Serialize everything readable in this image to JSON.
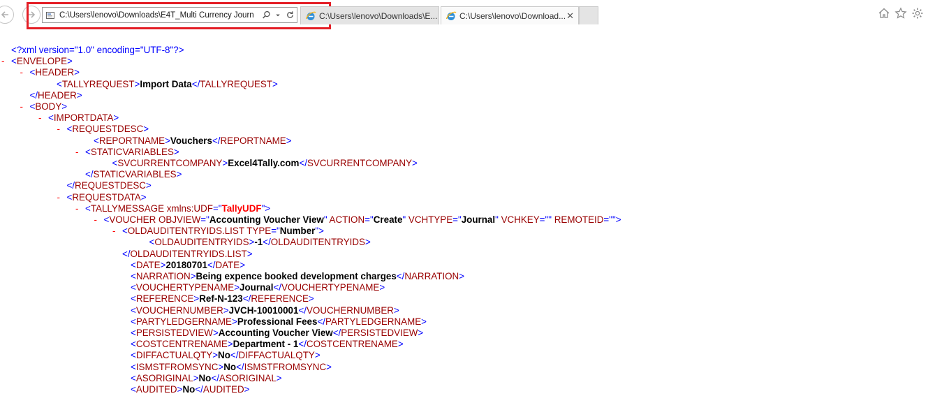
{
  "browser": {
    "address_url": "C:\\Users\\lenovo\\Downloads\\E4T_Multi Currency Journ",
    "tabs": [
      {
        "title": "C:\\Users\\lenovo\\Downloads\\E..."
      },
      {
        "title": "C:\\Users\\lenovo\\Download..."
      }
    ],
    "icons": [
      "back-icon",
      "forward-icon",
      "page-icon",
      "search-icon",
      "dropdown-icon",
      "refresh-icon",
      "ie-icon",
      "close-icon",
      "home-icon",
      "star-icon",
      "gear-icon"
    ],
    "colors": {
      "highlight": "#e41e26",
      "tag": "#990000",
      "bracket": "#0000ff",
      "minus": "#ff0000"
    }
  },
  "xml": {
    "declaration": "<?xml version=\"1.0\" encoding=\"UTF-8\"?>",
    "lines": [
      {
        "open": "ENVELOPE"
      },
      {
        "open": "HEADER"
      },
      {
        "tag": "TALLYREQUEST",
        "value": "Import Data"
      },
      {
        "close": "HEADER"
      },
      {
        "open": "BODY"
      },
      {
        "open": "IMPORTDATA"
      },
      {
        "open": "REQUESTDESC"
      },
      {
        "tag": "REPORTNAME",
        "value": "Vouchers"
      },
      {
        "open": "STATICVARIABLES"
      },
      {
        "tag": "SVCURRENTCOMPANY",
        "value": "Excel4Tally.com"
      },
      {
        "close": "STATICVARIABLES"
      },
      {
        "close": "REQUESTDESC"
      },
      {
        "open": "REQUESTDATA"
      },
      {
        "open": "TALLYMESSAGE",
        "attrs": [
          {
            "name": "xmlns:UDF",
            "value": "TallyUDF",
            "red": true
          }
        ]
      },
      {
        "open": "VOUCHER",
        "attrs": [
          {
            "name": "OBJVIEW",
            "value": "Accounting Voucher View"
          },
          {
            "name": "ACTION",
            "value": "Create"
          },
          {
            "name": "VCHTYPE",
            "value": "Journal"
          },
          {
            "name": "VCHKEY",
            "value": ""
          },
          {
            "name": "REMOTEID",
            "value": ""
          }
        ]
      },
      {
        "open": "OLDAUDITENTRYIDS.LIST",
        "attrs": [
          {
            "name": "TYPE",
            "value": "Number"
          }
        ]
      },
      {
        "tag": "OLDAUDITENTRYIDS",
        "value": "-1"
      },
      {
        "close": "OLDAUDITENTRYIDS.LIST"
      },
      {
        "tag": "DATE",
        "value": "20180701"
      },
      {
        "tag": "NARRATION",
        "value": "Being expence booked development charges"
      },
      {
        "tag": "VOUCHERTYPENAME",
        "value": "Journal"
      },
      {
        "tag": "REFERENCE",
        "value": "Ref-N-123"
      },
      {
        "tag": "VOUCHERNUMBER",
        "value": "JVCH-10010001"
      },
      {
        "tag": "PARTYLEDGERNAME",
        "value": "Professional Fees"
      },
      {
        "tag": "PERSISTEDVIEW",
        "value": "Accounting Voucher View"
      },
      {
        "tag": "COSTCENTRENAME",
        "value": "Department - 1"
      },
      {
        "tag": "DIFFACTUALQTY",
        "value": "No"
      },
      {
        "tag": "ISMSTFROMSYNC",
        "value": "No"
      },
      {
        "tag": "ASORIGINAL",
        "value": "No"
      },
      {
        "tag": "AUDITED",
        "value": "No"
      }
    ]
  }
}
